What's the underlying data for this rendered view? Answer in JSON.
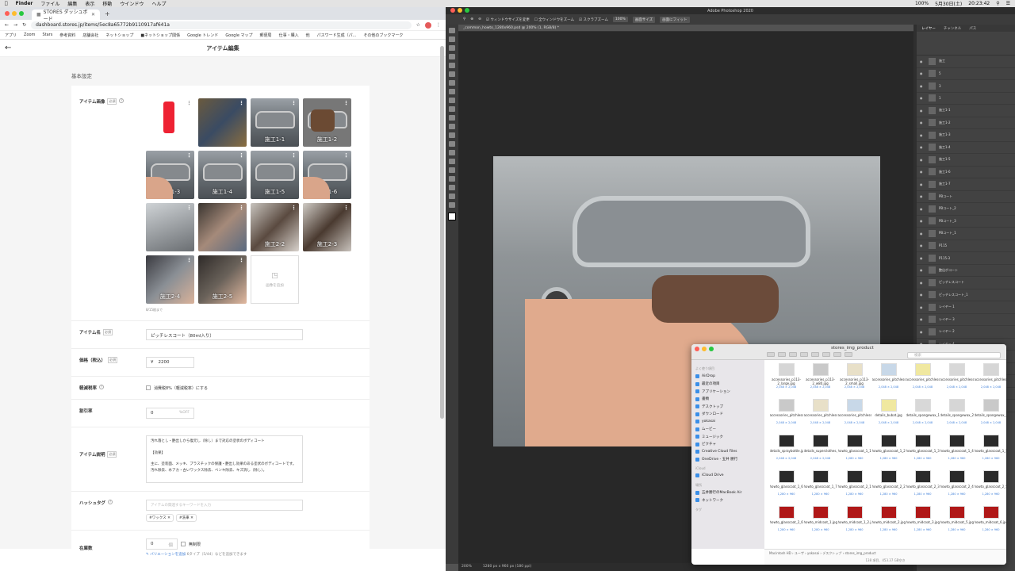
{
  "menubar": {
    "apple": "",
    "app": "Finder",
    "items": [
      "ファイル",
      "編集",
      "表示",
      "移動",
      "ウインドウ",
      "ヘルプ"
    ],
    "right": [
      "100%",
      "5月30日(土)",
      "20:23:42"
    ]
  },
  "browser": {
    "tab_title": "STORES ダッシュボード",
    "url": "dashboard.stores.jp/items/5ec8a65772b9110917af641a",
    "bookmarks": [
      "アプリ",
      "Zoom",
      "Stars",
      "参考資料",
      "店舗会社",
      "ネットショップ",
      "■ネットショップ関係",
      "Google トレンド",
      "Google マップ",
      "郵便局",
      "仕事・購入",
      "他",
      "パスワード生成（パ...",
      "その他のブックマーク"
    ],
    "page_title": "アイテム編集",
    "section": "基本設定",
    "images": {
      "label": "アイテム画像",
      "req": "必須",
      "add_label": "画像を追加",
      "note": "8/15枚まで",
      "captions": [
        "",
        "",
        "施工1-1",
        "施工1-2",
        "施工1-3",
        "施工1-4",
        "施工1-5",
        "施工1-6",
        "",
        "",
        "施工2-2",
        "施工2-3",
        "施工2-4",
        "施工2-5"
      ]
    },
    "name": {
      "label": "アイテム名",
      "req": "必須",
      "value": "ピッチレスコート（80ml入り）"
    },
    "price": {
      "label": "価格（税込）",
      "req": "必須",
      "currency": "¥",
      "value": "2200"
    },
    "tax": {
      "label": "軽減税率",
      "text": "消費税8%（軽減税率）にする"
    },
    "discount": {
      "label": "割引率",
      "value": "0",
      "unit": "%OFF"
    },
    "desc": {
      "label": "アイテム説明",
      "req": "必須",
      "lines": [
        "汚れ落とし・艶出しから復元し（除し）まで対応の塗状のボディコート",
        "",
        "【効果】",
        "",
        "主に、塗装面、メッキ、プラスチックの保護・艶出し効果のある塗状のボディコートです。",
        "汚れ除去、水アカ・古いワックス除去、ベンキ除去、キズ消し（除し）。"
      ]
    },
    "hashtag": {
      "label": "ハッシュタグ",
      "placeholder": "アイテムの関連するキーワードを入力",
      "tags": [
        "#ワックス",
        "#洗車"
      ]
    },
    "stock": {
      "label": "在庫数",
      "value": "0",
      "unit": "個",
      "unlimited": "無制限",
      "variation_link": "バリエーションを追加",
      "variation_note": "6タイプ（5/44）などを追加できます"
    }
  },
  "photoshop": {
    "title": "Adobe Photoshop 2020",
    "doc_tab": "_common_howto_1280x960.psd @ 200% (1, RGB/8) *",
    "options": [
      "ウィンドウサイズを変更",
      "全ウィンドウをズーム",
      "スクラブズーム",
      "100%",
      "画面サイズ",
      "画面にフィット"
    ],
    "status": [
      "200%",
      "1280 px x 960 px (180 ppi)"
    ],
    "panel_tabs": [
      "レイヤー",
      "チャンネル",
      "パス"
    ],
    "layers": [
      "施工",
      "5",
      "3",
      "1",
      "施工1-1",
      "施工1-2",
      "施工1-3",
      "施工1-4",
      "施工1-5",
      "施工1-6",
      "施工1-7",
      "PBコート",
      "PBコート_2",
      "PBコート_3",
      "PBコート_1",
      "P115",
      "P115-3",
      "艶出ボコート",
      "ピッチレスコート",
      "ピッチレスコート_1",
      "レイヤー 1",
      "レイヤー 3",
      "レイヤー 2",
      "レイヤー 4",
      "ピッチレスコート_2",
      "ピッチレスコート_3",
      "レイヤー 16",
      "レイヤー 17",
      "レイヤー 18"
    ]
  },
  "finder": {
    "title": "stores_img_product",
    "search": "検索",
    "sidebar": {
      "fav_head": "よく使う項目",
      "favs": [
        "AirDrop",
        "最近の項目",
        "アプリケーション",
        "書類",
        "デスクトップ",
        "ダウンロード",
        "yokasai",
        "ムービー",
        "ミュージック",
        "ピクチャ",
        "Creative Cloud Files",
        "OneDrive - 五井 勝行"
      ],
      "icloud_head": "iCloud",
      "icloud": [
        "iCloud Drive"
      ],
      "place_head": "場所",
      "places": [
        "五井勝行のMacBook Air",
        "ネットワーク"
      ],
      "tag_head": "タグ"
    },
    "files": [
      {
        "n": "accessories_p113-2_large.jpg",
        "s": "2,048 × 2,048"
      },
      {
        "n": "accessories_p113-2_w80.jpg",
        "s": "2,048 × 2,048"
      },
      {
        "n": "accessories_p113-2_small.jpg",
        "s": "2,048 × 2,048"
      },
      {
        "n": "accessories_pitchless_large.jpg",
        "s": "2,048 × 2,048"
      },
      {
        "n": "accessories_pitchless_w.jpg",
        "s": "2,048 × 2,048"
      },
      {
        "n": "accessories_pitchless_w1.jpg",
        "s": "2,048 × 2,048"
      },
      {
        "n": "accessories_pitchless_w2.jpg",
        "s": "2,048 × 2,048"
      },
      {
        "n": "accessories_pitchless_w12.jpg",
        "s": "2,048 × 2,048"
      },
      {
        "n": "accessories_pitchless_w02.jpg",
        "s": "2,048 × 2,048"
      },
      {
        "n": "accessories_pitchless_w13.jpg",
        "s": "2,048 × 2,048"
      },
      {
        "n": "details_bubat.jpg",
        "s": "2,048 × 2,048"
      },
      {
        "n": "details_spongewax_1.jpg",
        "s": "2,048 × 2,048"
      },
      {
        "n": "details_spongewax_2.jpg",
        "s": "2,048 × 2,048"
      },
      {
        "n": "details_spongewax_3.jpg",
        "s": "2,048 × 2,048"
      },
      {
        "n": "details_spraybottle.jpg",
        "s": "2,048 × 2,048"
      },
      {
        "n": "details_superclothes.jpg",
        "s": "2,048 × 2,048"
      },
      {
        "n": "howto_glasscoat_1_1.jpg",
        "s": "1,280 × 960"
      },
      {
        "n": "howto_glasscoat_1_2.jpg",
        "s": "1,280 × 960"
      },
      {
        "n": "howto_glasscoat_1_3.jpg",
        "s": "1,280 × 960"
      },
      {
        "n": "howto_glasscoat_1_4.jpg",
        "s": "1,280 × 960"
      },
      {
        "n": "howto_glasscoat_1_5.jpg",
        "s": "1,280 × 960"
      },
      {
        "n": "howto_glasscoat_1_6.jpg",
        "s": "1,280 × 960"
      },
      {
        "n": "howto_glasscoat_1_7.jpg",
        "s": "1,280 × 960"
      },
      {
        "n": "howto_glasscoat_2_1.jpg",
        "s": "1,280 × 960"
      },
      {
        "n": "howto_glasscoat_2_2.jpg",
        "s": "1,280 × 960"
      },
      {
        "n": "howto_glasscoat_2_3.jpg",
        "s": "1,280 × 960"
      },
      {
        "n": "howto_glasscoat_2_4.jpg",
        "s": "1,280 × 960"
      },
      {
        "n": "howto_glasscoat_2_5.jpg",
        "s": "1,280 × 960"
      },
      {
        "n": "howto_glasscoat_2_6.jpg",
        "s": "1,280 × 960"
      },
      {
        "n": "howto_midcoat_1.jpg",
        "s": "1,280 × 960"
      },
      {
        "n": "howto_midcoat_1_2.jpg",
        "s": "1,280 × 960"
      },
      {
        "n": "howto_midcoat_2.jpg",
        "s": "1,280 × 960"
      },
      {
        "n": "howto_midcoat_3.jpg",
        "s": "1,280 × 960"
      },
      {
        "n": "howto_midcoat_5.jpg",
        "s": "1,280 × 960"
      },
      {
        "n": "howto_midcoat_6.jpg",
        "s": "1,280 × 960"
      }
    ],
    "path": [
      "Macintosh HD",
      "ユーザ",
      "yokasai",
      "デスクトップ",
      "stores_img_product"
    ],
    "status": "138 項目、453.37 GB空き"
  }
}
